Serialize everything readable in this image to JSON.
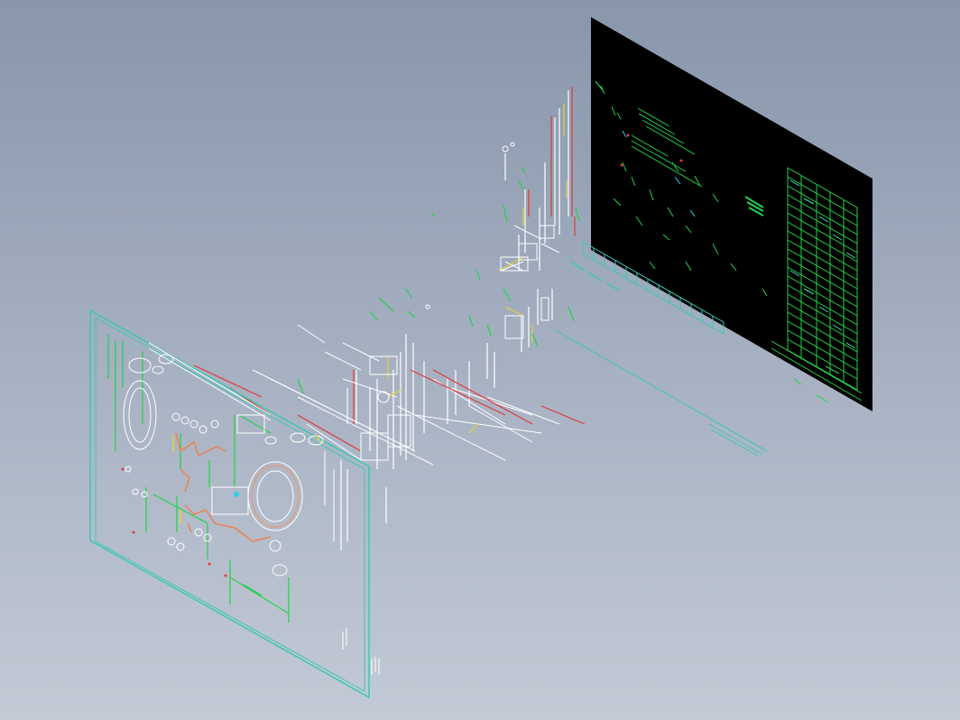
{
  "viewport": {
    "background_top": "#8896ac",
    "background_bottom": "#c3cad6"
  },
  "colors": {
    "frame": "#3cc8b4",
    "sheet_background": "#000000",
    "white_lines": "#ffffff",
    "red_lines": "#e03a3a",
    "green_lines": "#22d24a",
    "yellow_lines": "#e6d23a",
    "orange_lines": "#f08050",
    "cyan_lines": "#33ccee"
  },
  "scene": {
    "front_drawing_sheet": "wireframe-with-frame",
    "rear_drawing_sheet": "black-title-block-sheet",
    "exploded_geometry": "scattered-3d-line-fragments"
  }
}
